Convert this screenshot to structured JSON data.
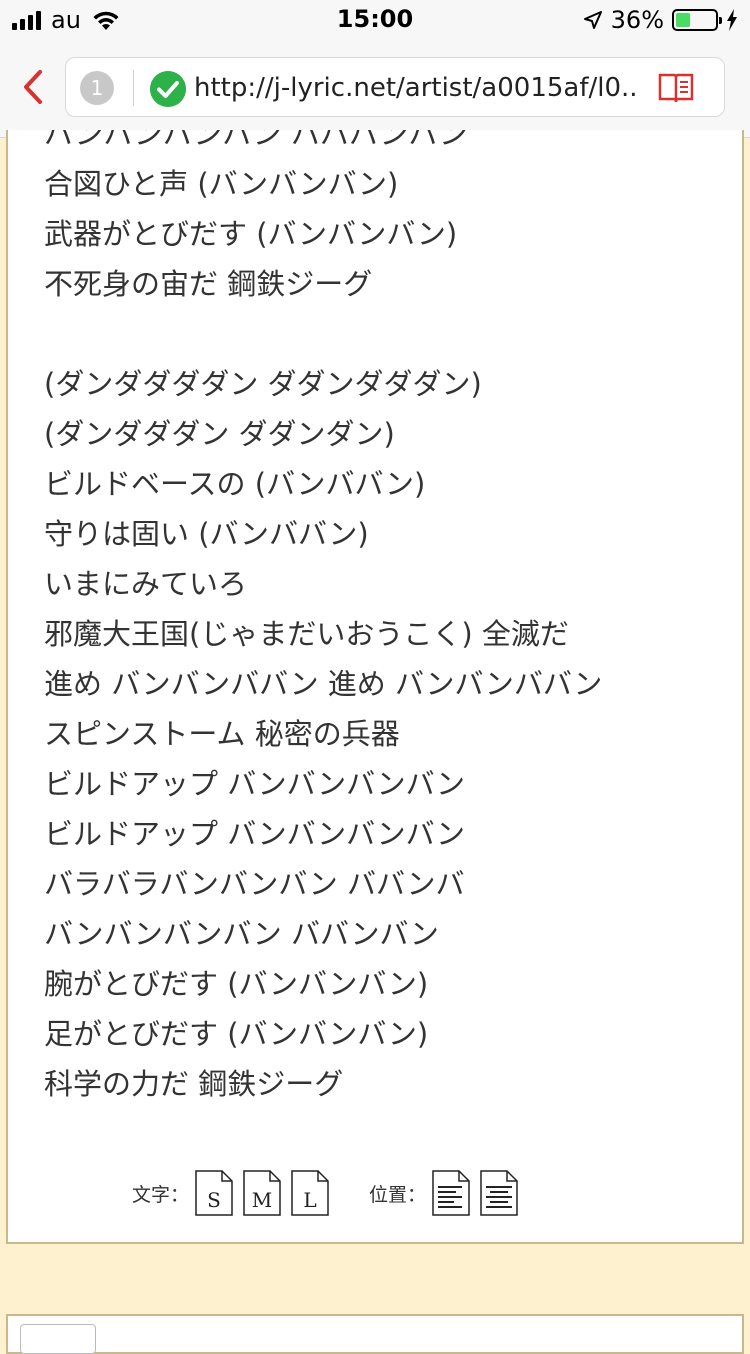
{
  "status": {
    "carrier": "au",
    "time": "15:00",
    "battery_percent": "36%",
    "battery_level": 0.36
  },
  "browser": {
    "tab_count": "1",
    "url": "http://j-lyric.net/artist/a0015af/l0..."
  },
  "lyrics": [
    "バンバンバンバン バババンバン",
    "合図ひと声 (バンバンバン)",
    "武器がとびだす (バンバンバン)",
    "不死身の宙だ 鋼鉄ジーグ",
    "",
    "(ダンダダダダン ダダンダダダン)",
    "(ダンダダダン ダダンダン)",
    "ビルドベースの (バンババン)",
    "守りは固い (バンババン)",
    "いまにみていろ",
    "邪魔大王国(じゃまだいおうこく) 全滅だ",
    "進め バンバンババン 進め バンバンババン",
    "スピンストーム 秘密の兵器",
    "ビルドアップ バンバンバンバン",
    "ビルドアップ バンバンバンバン",
    "バラバラバンバンバン ババンバ",
    "バンバンバンバン ババンバン",
    "腕がとびだす (バンバンバン)",
    "足がとびだす (バンバンバン)",
    "科学の力だ 鋼鉄ジーグ"
  ],
  "controls": {
    "font_label": "文字：",
    "size_s": "S",
    "size_m": "M",
    "size_l": "L",
    "position_label": "位置："
  }
}
